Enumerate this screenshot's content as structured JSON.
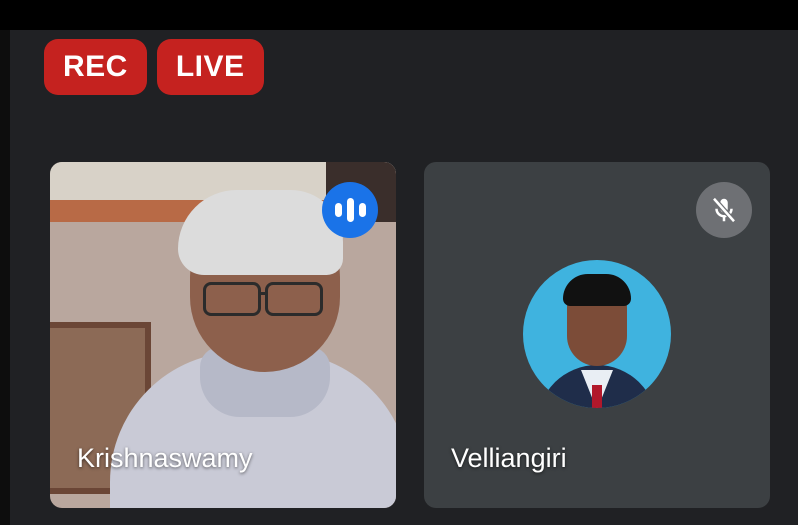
{
  "status": {
    "rec_label": "REC",
    "live_label": "LIVE",
    "badge_color": "#c5221f"
  },
  "participants": [
    {
      "name": "Krishnaswamy",
      "state": "speaking",
      "indicator_icon": "audio-wave-icon",
      "indicator_color": "#1a73e8"
    },
    {
      "name": "Velliangiri",
      "state": "muted",
      "indicator_icon": "mic-off-icon",
      "indicator_color": "#6e7074"
    }
  ]
}
